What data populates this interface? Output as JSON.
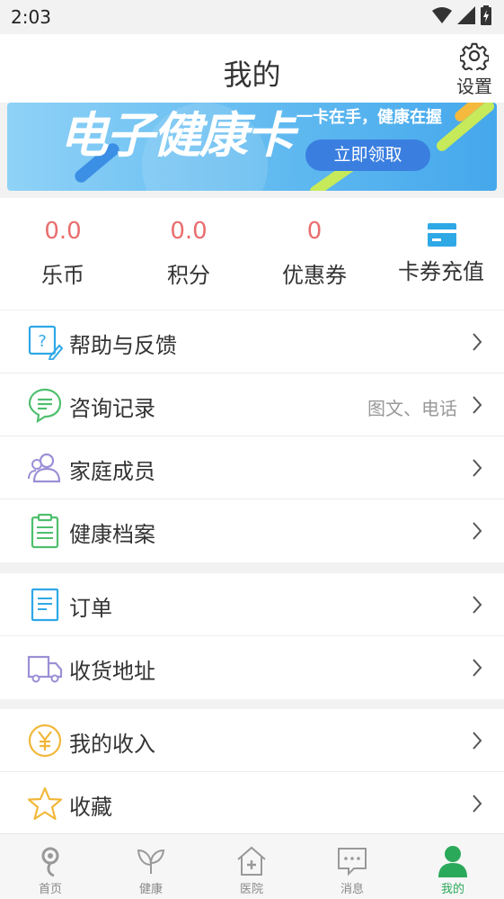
{
  "status_bar": {
    "time": "2:03"
  },
  "header": {
    "title": "我的",
    "settings_label": "设置"
  },
  "banner": {
    "title": "电子健康卡",
    "slogan": "一卡在手，健康在握",
    "button_label": "立即领取"
  },
  "stats": [
    {
      "value": "0.0",
      "label": "乐币"
    },
    {
      "value": "0.0",
      "label": "积分"
    },
    {
      "value": "0",
      "label": "优惠券"
    },
    {
      "icon": "card-icon",
      "label": "卡券充值"
    }
  ],
  "menu": {
    "help": {
      "label": "帮助与反馈",
      "icon": "help-feedback-icon"
    },
    "consult": {
      "label": "咨询记录",
      "detail": "图文、电话",
      "icon": "chat-icon"
    },
    "family": {
      "label": "家庭成员",
      "icon": "family-members-icon"
    },
    "records": {
      "label": "健康档案",
      "icon": "clipboard-icon"
    },
    "orders": {
      "label": "订单",
      "icon": "document-icon"
    },
    "address": {
      "label": "收货地址",
      "icon": "truck-icon"
    },
    "income": {
      "label": "我的收入",
      "icon": "yuan-icon"
    },
    "favorites": {
      "label": "收藏",
      "icon": "star-icon"
    }
  },
  "tabbar": {
    "home": "首页",
    "health": "健康",
    "hospital": "医院",
    "messages": "消息",
    "mine": "我的"
  },
  "colors": {
    "accent_green": "#2aa95a",
    "stat_red": "#e96d6d",
    "banner_blue": "#61baf0"
  }
}
